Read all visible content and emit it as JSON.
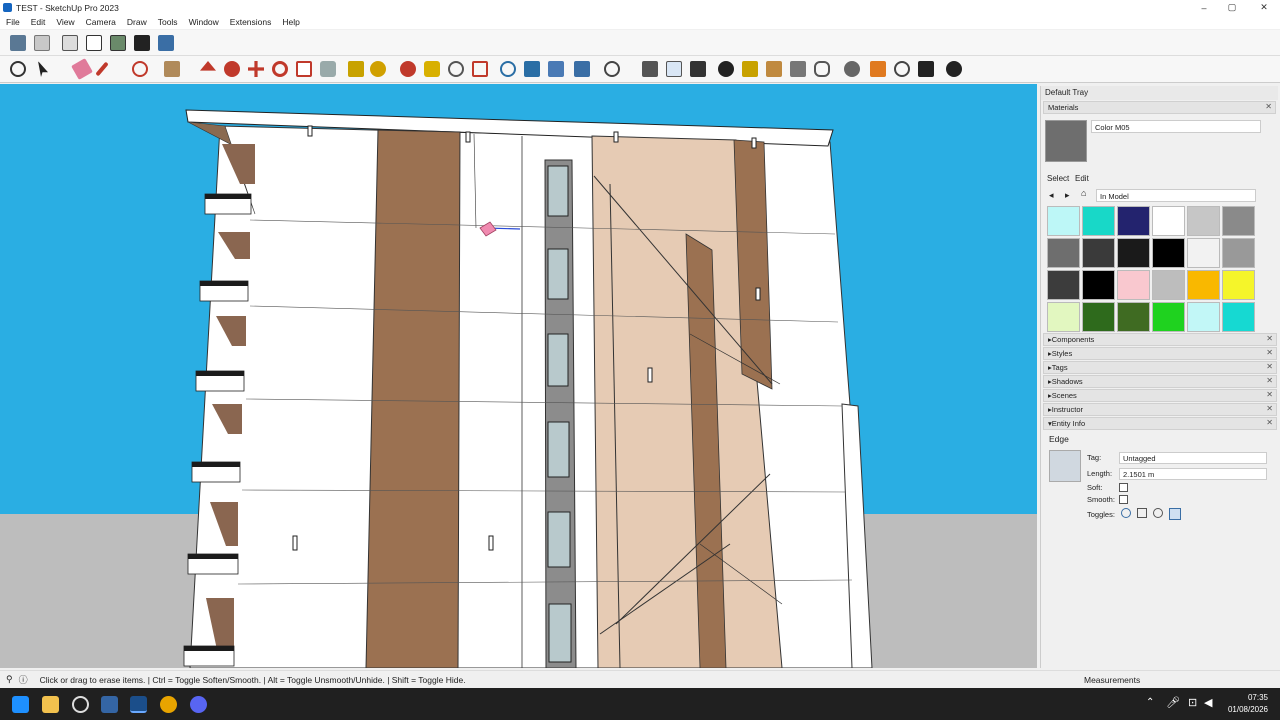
{
  "window": {
    "title": "TEST - SketchUp Pro 2023",
    "minimize": "–",
    "maximize": "▢",
    "close": "✕"
  },
  "menu": [
    "File",
    "Edit",
    "View",
    "Camera",
    "Draw",
    "Tools",
    "Window",
    "Extensions",
    "Help"
  ],
  "toolbar": {
    "row1_icons": [
      "box-icon",
      "wireframe-icon",
      "hidden-line-icon",
      "shaded-icon",
      "textured-icon",
      "monochrome-icon",
      "xray-icon"
    ],
    "row2_icons": [
      "zoom-icon",
      "select-icon",
      "eraser-icon",
      "pencil-icon",
      "lasso-icon",
      "paint-bucket-icon",
      "push-pull-icon",
      "follow-me-icon",
      "move-icon",
      "rotate-icon",
      "scale-icon",
      "offset-icon",
      "tape-icon",
      "paint-icon",
      "orbit-icon",
      "pan-icon",
      "zoom-window-icon",
      "zoom-extents-icon",
      "sandbox-icon",
      "layers-icon",
      "section-icon",
      "styles-icon",
      "profile-icon",
      "components-icon",
      "materials-icon",
      "outliner-icon",
      "add-location-icon",
      "photo-texture-icon",
      "extension-warehouse-icon",
      "3d-warehouse-icon",
      "cloud-icon",
      "settings-icon",
      "scenes-icon",
      "info-icon",
      "cart-icon",
      "account-icon"
    ]
  },
  "tray": {
    "title": "Default Tray",
    "materials": {
      "header": "Materials",
      "color_name": "Color M05",
      "tab_select": "Select",
      "tab_edit": "Edit",
      "collection": "In Model",
      "swatches": [
        "#bdf7f7",
        "#18d8c8",
        "#23236e",
        "#ffffff",
        "#c6c6c6",
        "#8a8a8a",
        "#6e6e6e",
        "#3a3a3a",
        "#1a1a1a",
        "#000000",
        "#f2f2f2",
        "#999999",
        "#3c3c3c",
        "#000000",
        "#f9c8cf",
        "#bdbdbd",
        "#f9b800",
        "#f5f52a",
        "#e2f7c0",
        "#2e6a1c",
        "#3f6b22",
        "#1fd21f",
        "#c2f7f7",
        "#16d9d2"
      ]
    },
    "panels": [
      "Components",
      "Styles",
      "Tags",
      "Shadows",
      "Scenes",
      "Instructor"
    ],
    "entity_info": {
      "header": "Entity Info",
      "entity": "Edge",
      "tag_label": "Tag:",
      "tag_value": "Untagged",
      "length_label": "Length:",
      "length_value": "2.1501 m",
      "soft_label": "Soft:",
      "smooth_label": "Smooth:",
      "toggles_label": "Toggles:"
    }
  },
  "status": {
    "message": "Click or drag to erase items. | Ctrl = Toggle Soften/Smooth. | Alt = Toggle Unsmooth/Unhide. | Shift = Toggle Hide.",
    "measurements_label": "Measurements"
  },
  "taskbar": {
    "time": "07:35",
    "date": "01/08/2026",
    "icons": [
      "windows-start-icon",
      "file-explorer-icon",
      "app-icon",
      "settings-icon",
      "sketchup-icon",
      "chrome-icon",
      "discord-icon"
    ]
  },
  "colors": {
    "sky": "#2aaee3",
    "ground": "#bdbdbd",
    "wall": "#ffffff",
    "brown": "#9b7151",
    "beige": "#e6cbb4"
  }
}
